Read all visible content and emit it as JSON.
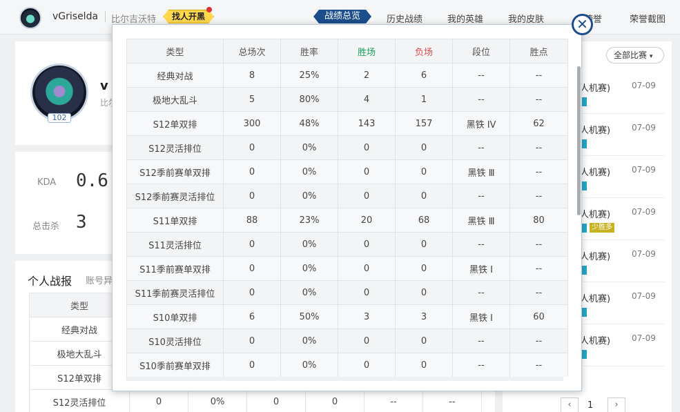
{
  "header": {
    "username": "vGriselda",
    "server": "比尔吉沃特",
    "find_team": "找人开黑",
    "nav": [
      "战绩总览",
      "历史战绩",
      "我的英雄",
      "我的皮肤",
      "荣誉",
      "荣誉截图"
    ]
  },
  "profile": {
    "name_partial": "v",
    "sub_partial": "比尔",
    "level": "102"
  },
  "kda": {
    "kda_label": "KDA",
    "kda_value": "0.6",
    "kills_label": "总击杀",
    "kills_value": "3"
  },
  "report": {
    "title": "个人战报",
    "subtitle": "账号异",
    "header": "类型",
    "rows": [
      [
        "经典对战"
      ],
      [
        "极地大乱斗"
      ],
      [
        "S12单双排"
      ],
      [
        "S12灵活排位",
        "0",
        "0%",
        "0",
        "0",
        "--",
        "--"
      ]
    ]
  },
  "matches": {
    "filter": "全部比赛",
    "items": [
      {
        "name": "人机赛)",
        "date": "07-09"
      },
      {
        "name": "人机赛)",
        "date": "07-09"
      },
      {
        "name": "人机赛)",
        "date": "07-09"
      },
      {
        "name": "人机赛)",
        "date": "07-09",
        "tag": "少胜多"
      },
      {
        "name": "人机赛)",
        "date": "07-09"
      },
      {
        "name": "人机赛)",
        "date": "07-09"
      },
      {
        "name": "人机赛)",
        "date": "07-09"
      }
    ],
    "page": "1"
  },
  "modal": {
    "columns": [
      "类型",
      "总场次",
      "胜率",
      "胜场",
      "负场",
      "段位",
      "胜点"
    ],
    "rows": [
      [
        "经典对战",
        "8",
        "25%",
        "2",
        "6",
        "--",
        "--"
      ],
      [
        "极地大乱斗",
        "5",
        "80%",
        "4",
        "1",
        "--",
        "--"
      ],
      [
        "S12单双排",
        "300",
        "48%",
        "143",
        "157",
        "黑铁 IV",
        "62"
      ],
      [
        "S12灵活排位",
        "0",
        "0%",
        "0",
        "0",
        "--",
        "--"
      ],
      [
        "S12季前赛单双排",
        "0",
        "0%",
        "0",
        "0",
        "黑铁 Ⅲ",
        "--"
      ],
      [
        "S12季前赛灵活排位",
        "0",
        "0%",
        "0",
        "0",
        "--",
        "--"
      ],
      [
        "S11单双排",
        "88",
        "23%",
        "20",
        "68",
        "黑铁 Ⅲ",
        "80"
      ],
      [
        "S11灵活排位",
        "0",
        "0%",
        "0",
        "0",
        "--",
        "--"
      ],
      [
        "S11季前赛单双排",
        "0",
        "0%",
        "0",
        "0",
        "黑铁 Ⅰ",
        "--"
      ],
      [
        "S11季前赛灵活排位",
        "0",
        "0%",
        "0",
        "0",
        "--",
        "--"
      ],
      [
        "S10单双排",
        "6",
        "50%",
        "3",
        "3",
        "黑铁 Ⅰ",
        "60"
      ],
      [
        "S10灵活排位",
        "0",
        "0%",
        "0",
        "0",
        "--",
        "--"
      ],
      [
        "S10季前赛单双排",
        "0",
        "0%",
        "0",
        "0",
        "--",
        "--"
      ]
    ],
    "close_glyph": "✕"
  },
  "colors": {
    "accent": "#1c4d8c",
    "win": "#1ca15a",
    "lose": "#e04848",
    "find_btn": "#ffd84d"
  }
}
